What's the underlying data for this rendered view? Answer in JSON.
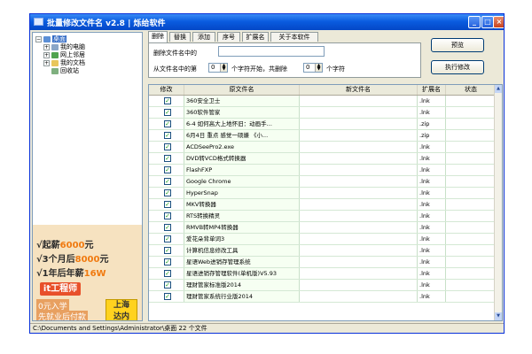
{
  "window": {
    "title": "批量修改文件名 v2.8",
    "title_sep": "|",
    "publisher": "烁给软件"
  },
  "tree": {
    "root": "桌面",
    "items": [
      "我的电脑",
      "网上邻居",
      "我的文档",
      "回收站"
    ]
  },
  "tabs": [
    "删除",
    "替换",
    "添加",
    "序号",
    "扩展名",
    "关于本软件"
  ],
  "delete_panel": {
    "label1": "删除文件名中的",
    "input_value": "",
    "label2_prefix": "从文件名中的第",
    "start_value": "0",
    "label2_mid": "个字符开始，共删除",
    "count_value": "0",
    "label2_suffix": "个字符"
  },
  "buttons": {
    "preview": "预览",
    "execute": "执行修改"
  },
  "table": {
    "columns": [
      "修改",
      "原文件名",
      "新文件名",
      "扩展名",
      "状态"
    ],
    "rows": [
      {
        "name": "360安全卫士",
        "ext": ".lnk"
      },
      {
        "name": "360软件管家",
        "ext": ".lnk"
      },
      {
        "name": "6-4  如何高大上地怀旧：动画手...",
        "ext": ".zip"
      },
      {
        "name": "6月4日 重点   感觉一硕嫌 《小...",
        "ext": ".zip"
      },
      {
        "name": "ACDSeePro2.exe",
        "ext": ".lnk"
      },
      {
        "name": "DVD转VCD格式转换器",
        "ext": ".lnk"
      },
      {
        "name": "FlashFXP",
        "ext": ".lnk"
      },
      {
        "name": "Google Chrome",
        "ext": ".lnk"
      },
      {
        "name": "HyperSnap",
        "ext": ".lnk"
      },
      {
        "name": "MKV转换器",
        "ext": ".lnk"
      },
      {
        "name": "RTS转换精灵",
        "ext": ".lnk"
      },
      {
        "name": "RMVB转MP4转换器",
        "ext": ".lnk"
      },
      {
        "name": "爱花朵背单词3",
        "ext": ".lnk"
      },
      {
        "name": "计算机信息修改工具",
        "ext": ".lnk"
      },
      {
        "name": "星语Web进销存管理系统",
        "ext": ".lnk"
      },
      {
        "name": "星语进销存管理软件(单机版)V5.93",
        "ext": ".lnk"
      },
      {
        "name": "理财管家标准版2014",
        "ext": ".lnk"
      },
      {
        "name": "理财管家系统行业版2014",
        "ext": ".lnk"
      }
    ]
  },
  "ad": {
    "line1a": "√起薪",
    "line1b": "6000",
    "line1c": "元",
    "line2a": "√3个月后",
    "line2b": "8000",
    "line2c": "元",
    "line3a": "√1年后年薪",
    "line3b": "16W",
    "banner": "it工程师",
    "sub1": "0元入学",
    "sub2": "先就业后付款",
    "box1": "上海",
    "box2": "达内"
  },
  "status": "C:\\Documents and Settings\\Administrator\\桌面 22 个文件"
}
